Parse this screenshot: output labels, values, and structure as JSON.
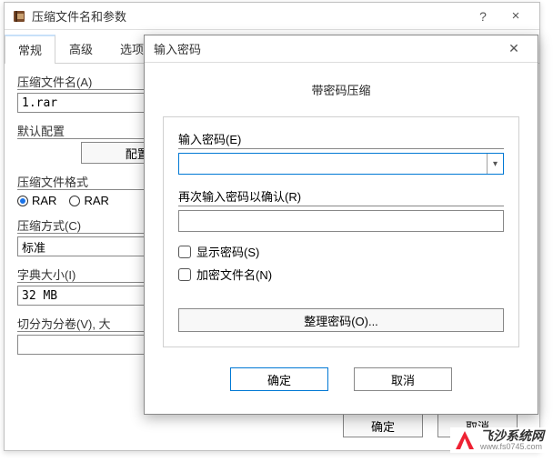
{
  "back": {
    "title": "压缩文件名和参数",
    "tabs": [
      "常规",
      "高级",
      "选项"
    ],
    "archive_name_label": "压缩文件名(A)",
    "archive_name_value": "1.rar",
    "default_profile_label": "默认配置",
    "profiles_button": "配置(F)",
    "format_label": "压缩文件格式",
    "format_options": {
      "rar": "RAR",
      "rar4": "RAR"
    },
    "method_label": "压缩方式(C)",
    "method_value": "标准",
    "dict_label": "字典大小(I)",
    "dict_value": "32 MB",
    "split_label": "切分为分卷(V),  大",
    "buttons": {
      "ok": "确定",
      "cancel": "取消"
    }
  },
  "front": {
    "title": "输入密码",
    "heading": "带密码压缩",
    "pw_label": "输入密码(E)",
    "confirm_label": "再次输入密码以确认(R)",
    "show_pw": "显示密码(S)",
    "encrypt_names": "加密文件名(N)",
    "organize": "整理密码(O)...",
    "ok": "确定",
    "cancel": "取消"
  },
  "watermark": {
    "line1": "飞沙系统网",
    "line2": "www.fs0745.com"
  }
}
